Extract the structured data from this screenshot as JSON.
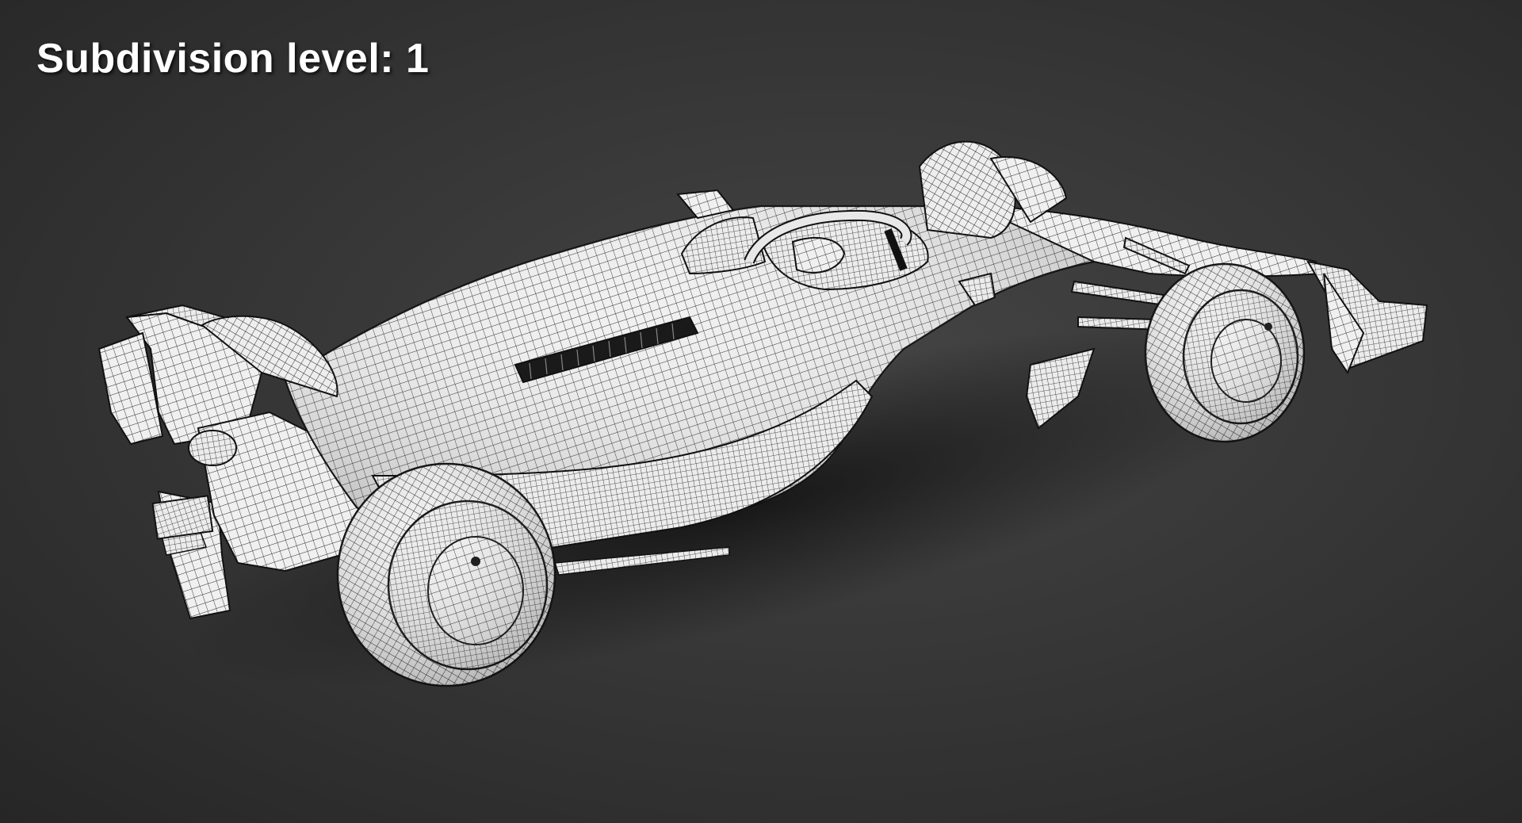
{
  "caption": {
    "text": "Subdivision level: 1"
  },
  "scene": {
    "subject": "car-wireframe-model",
    "colors": {
      "background": "#333333",
      "mesh_surface": "#f2f2f2",
      "wire": "#1a1a1a",
      "shadow": "#151515"
    }
  }
}
